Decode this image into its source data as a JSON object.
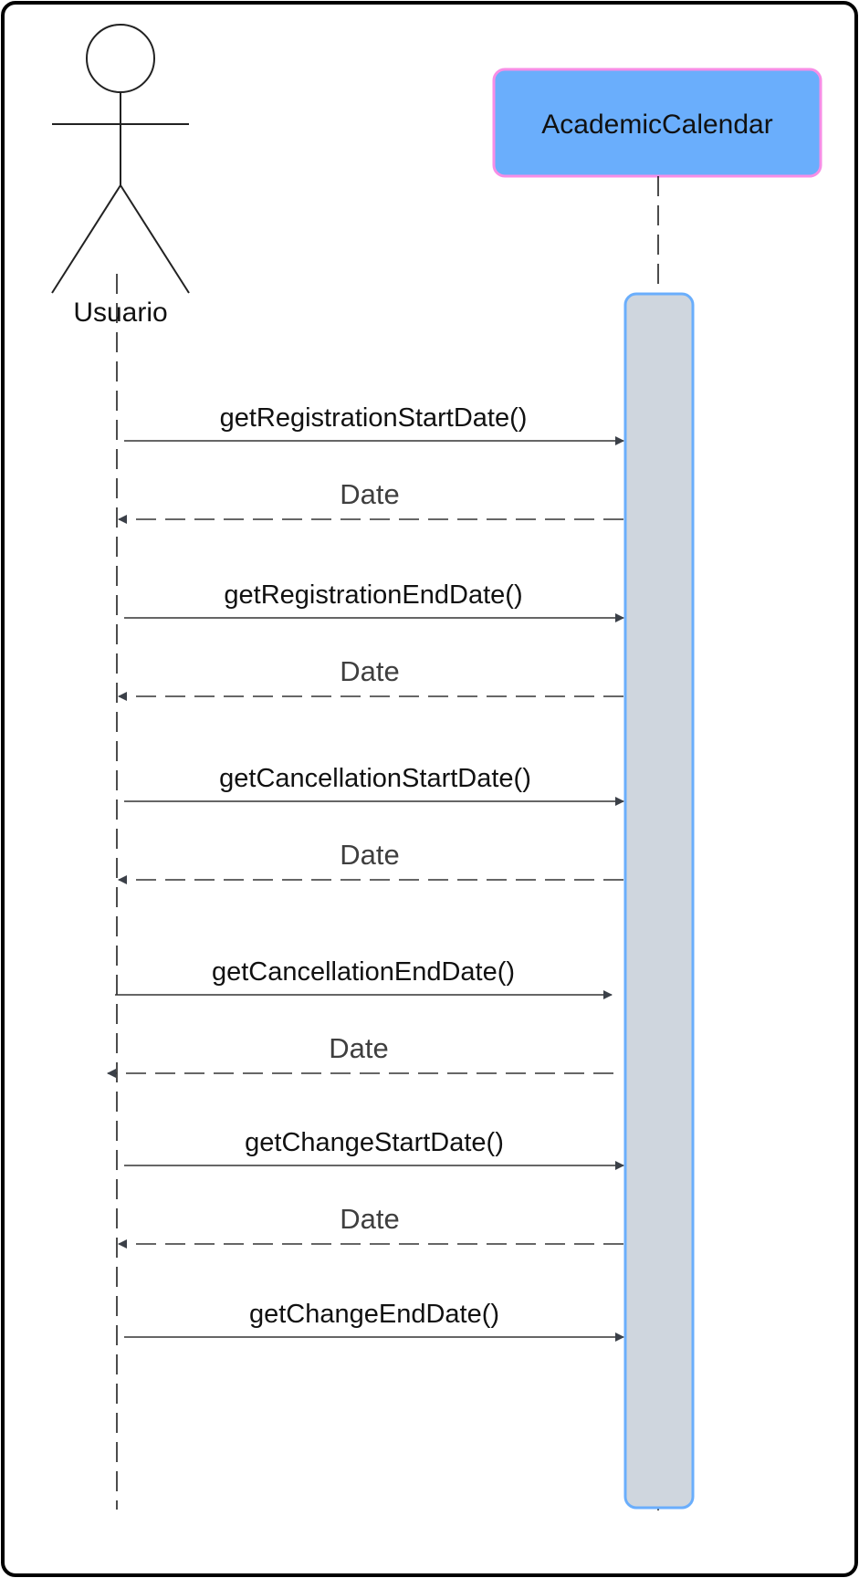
{
  "actor": {
    "name": "Usuario"
  },
  "participant": {
    "name": "AcademicCalendar"
  },
  "colors": {
    "frame_border": "#000000",
    "participant_fill": "#6aaefc",
    "participant_border": "#f78ee6",
    "activation_fill": "#cfd6de",
    "activation_border": "#6aaefc",
    "arrow": "#333333",
    "arrowhead": "#3b4048"
  },
  "messages": [
    {
      "kind": "call",
      "label": "getRegistrationStartDate()"
    },
    {
      "kind": "return",
      "label": "Date"
    },
    {
      "kind": "call",
      "label": "getRegistrationEndDate()"
    },
    {
      "kind": "return",
      "label": "Date"
    },
    {
      "kind": "call",
      "label": "getCancellationStartDate()"
    },
    {
      "kind": "return",
      "label": "Date"
    },
    {
      "kind": "call",
      "label": "getCancellationEndDate()"
    },
    {
      "kind": "return",
      "label": "Date"
    },
    {
      "kind": "call",
      "label": "getChangeStartDate()"
    },
    {
      "kind": "return",
      "label": "Date"
    },
    {
      "kind": "call",
      "label": "getChangeEndDate()"
    }
  ]
}
